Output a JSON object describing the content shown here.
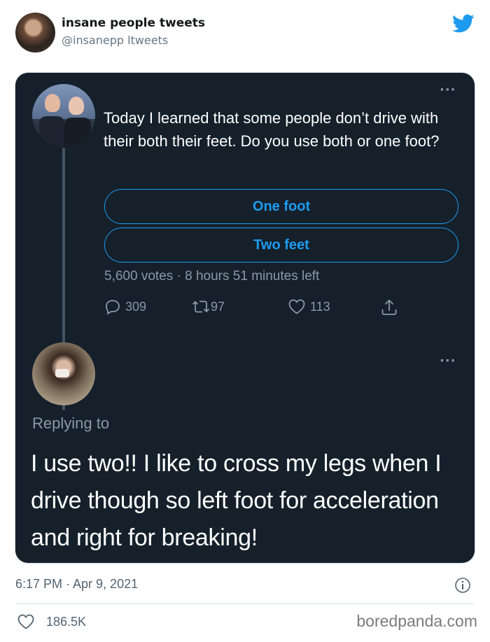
{
  "author": {
    "name": "insane people tweets",
    "handle": "@insanepp ltweets"
  },
  "brand_color": "#1d9bf0",
  "quoted": {
    "tweet1": {
      "text": "Today I learned that some people don’t drive with their both their feet. Do you use both or one foot?",
      "poll": {
        "options": [
          "One foot",
          "Two feet"
        ],
        "meta": "5,600 votes · 8 hours 51 minutes left"
      },
      "actions": {
        "replies": "309",
        "retweets": "97",
        "likes": "113"
      }
    },
    "tweet2": {
      "replying_to": "Replying to",
      "text": "I use two!! I like to cross my legs when I drive though so left foot for acceleration and right for breaking!"
    }
  },
  "footer": {
    "timestamp": "6:17 PM · Apr 9, 2021",
    "likes": "186.5K",
    "watermark": "boredpanda.com"
  },
  "icons": [
    "twitter-bird-icon",
    "more-dots-icon",
    "reply-icon",
    "retweet-icon",
    "heart-icon",
    "share-icon",
    "info-icon"
  ]
}
